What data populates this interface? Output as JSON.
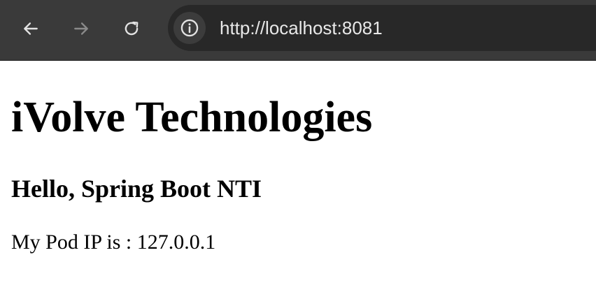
{
  "browser": {
    "url": "http://localhost:8081",
    "icons": {
      "back": "arrow-left-icon",
      "forward": "arrow-right-icon",
      "reload": "reload-icon",
      "site_info": "info-icon"
    },
    "forward_enabled": false
  },
  "page": {
    "title": "iVolve Technologies",
    "subtitle": "Hello, Spring Boot NTI",
    "pod_ip_text": "My Pod IP is : 127.0.0.1"
  },
  "colors": {
    "toolbar_bg": "#3a3a3a",
    "omnibox_bg": "#282828",
    "icon_active": "#e3e3e3",
    "icon_disabled": "#8a8a8a",
    "page_bg": "#ffffff",
    "page_text": "#000000"
  }
}
